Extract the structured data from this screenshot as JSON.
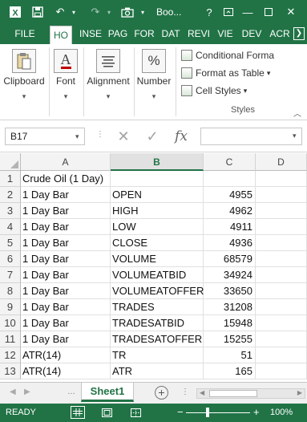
{
  "titlebar": {
    "title": "Boo...",
    "background": "#217346"
  },
  "tabs": [
    {
      "label": "FILE"
    },
    {
      "label": "HO"
    },
    {
      "label": "INSE"
    },
    {
      "label": "PAG"
    },
    {
      "label": "FOR"
    },
    {
      "label": "DAT"
    },
    {
      "label": "REVI"
    },
    {
      "label": "VIE"
    },
    {
      "label": "DEV"
    },
    {
      "label": "ACR"
    }
  ],
  "ribbon": {
    "clipboard": "Clipboard",
    "font": "Font",
    "alignment": "Alignment",
    "number": "Number",
    "conditional_formatting": "Conditional Forma",
    "format_as_table": "Format as Table",
    "cell_styles": "Cell Styles",
    "styles_group": "Styles"
  },
  "formula_bar": {
    "name_box": "B17",
    "formula": ""
  },
  "columns": [
    "A",
    "B",
    "C",
    "D"
  ],
  "selected_column": "B",
  "rows": [
    {
      "num": "1",
      "a": "Crude Oil (1 Day)",
      "b": "",
      "c": ""
    },
    {
      "num": "2",
      "a": "1 Day Bar",
      "b": "OPEN",
      "c": "4955"
    },
    {
      "num": "3",
      "a": "1 Day Bar",
      "b": "HIGH",
      "c": "4962"
    },
    {
      "num": "4",
      "a": "1 Day Bar",
      "b": "LOW",
      "c": "4911"
    },
    {
      "num": "5",
      "a": "1 Day Bar",
      "b": "CLOSE",
      "c": "4936"
    },
    {
      "num": "6",
      "a": "1 Day Bar",
      "b": "VOLUME",
      "c": "68579"
    },
    {
      "num": "7",
      "a": "1 Day Bar",
      "b": "VOLUMEATBID",
      "c": "34924"
    },
    {
      "num": "8",
      "a": "1 Day Bar",
      "b": "VOLUMEATOFFER",
      "c": "33650"
    },
    {
      "num": "9",
      "a": "1 Day Bar",
      "b": "TRADES",
      "c": "31208"
    },
    {
      "num": "10",
      "a": "1 Day Bar",
      "b": "TRADESATBID",
      "c": "15948"
    },
    {
      "num": "11",
      "a": "1 Day Bar",
      "b": "TRADESATOFFER",
      "c": "15255"
    },
    {
      "num": "12",
      "a": "ATR(14)",
      "b": "TR",
      "c": "51"
    },
    {
      "num": "13",
      "a": "ATR(14)",
      "b": "ATR",
      "c": "165"
    }
  ],
  "sheet_tabs": [
    {
      "label": "Sheet1",
      "active": true
    }
  ],
  "statusbar": {
    "ready": "READY",
    "zoom": "100%"
  }
}
